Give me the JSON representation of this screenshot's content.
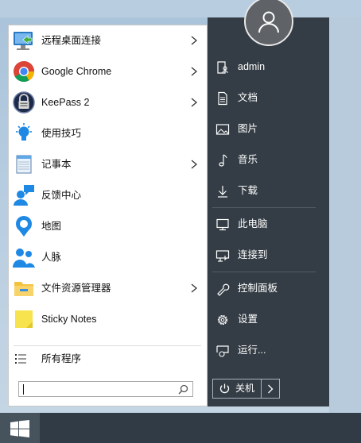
{
  "start_menu": {
    "programs": [
      {
        "label": "远程桌面连接",
        "icon": "remote-desktop-icon",
        "has_arrow": true
      },
      {
        "label": "Google Chrome",
        "icon": "chrome-icon",
        "has_arrow": true
      },
      {
        "label": "KeePass 2",
        "icon": "keepass-icon",
        "has_arrow": true
      },
      {
        "label": "使用技巧",
        "icon": "tips-icon",
        "has_arrow": false
      },
      {
        "label": "记事本",
        "icon": "notepad-icon",
        "has_arrow": true
      },
      {
        "label": "反馈中心",
        "icon": "feedback-icon",
        "has_arrow": false
      },
      {
        "label": "地图",
        "icon": "maps-icon",
        "has_arrow": false
      },
      {
        "label": "人脉",
        "icon": "people-icon",
        "has_arrow": false
      },
      {
        "label": "文件资源管理器",
        "icon": "file-explorer-icon",
        "has_arrow": true
      },
      {
        "label": "Sticky Notes",
        "icon": "sticky-notes-icon",
        "has_arrow": false
      }
    ],
    "all_programs_label": "所有程序",
    "search": {
      "placeholder": "",
      "value": ""
    },
    "right_panel": {
      "user": "admin",
      "items": [
        {
          "label": "文档",
          "icon": "document-icon"
        },
        {
          "label": "图片",
          "icon": "pictures-icon"
        },
        {
          "label": "音乐",
          "icon": "music-icon"
        },
        {
          "label": "下载",
          "icon": "download-icon"
        },
        {
          "label": "此电脑",
          "icon": "computer-icon"
        },
        {
          "label": "连接到",
          "icon": "connect-icon"
        },
        {
          "label": "控制面板",
          "icon": "control-panel-icon"
        },
        {
          "label": "设置",
          "icon": "settings-gear-icon"
        },
        {
          "label": "运行...",
          "icon": "run-icon"
        }
      ],
      "shutdown_label": "关机"
    }
  },
  "colors": {
    "right_panel_bg": "#343d45",
    "taskbar_bg": "#303b45",
    "left_panel_bg": "#ffffff"
  }
}
